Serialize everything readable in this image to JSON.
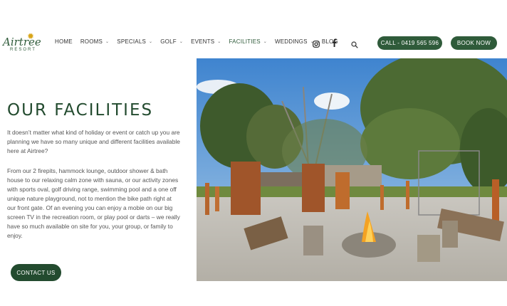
{
  "logo": {
    "name": "Airtree",
    "sub": "RESORT"
  },
  "nav": [
    {
      "label": "HOME",
      "dropdown": false
    },
    {
      "label": "ROOMS",
      "dropdown": true
    },
    {
      "label": "SPECIALS",
      "dropdown": true
    },
    {
      "label": "GOLF",
      "dropdown": true
    },
    {
      "label": "EVENTS",
      "dropdown": true
    },
    {
      "label": "FACILITIES",
      "dropdown": true
    },
    {
      "label": "WEDDINGS",
      "dropdown": true
    },
    {
      "label": "BLOG",
      "dropdown": false
    }
  ],
  "header": {
    "call_label": "CALL - 0419 565 596",
    "book_label": "BOOK NOW"
  },
  "main": {
    "title": "OUR FACILITIES",
    "intro": "It doesn’t matter what kind of holiday or event or catch up you are planning we have so many unique and different facilities available here at Airtree?",
    "body": "From our 2 firepits, hammock lounge, outdoor shower & bath house to our relaxing calm zone with sauna, or our activity zones with sports oval, golf driving range, swimming pool and a one off unique nature playground, not to mention the bike path right at our front gate. Of an evening you can enjoy a mobie on our big screen TV in the recreation room, or play pool or darts – we really have so much available on site for you, your group, or family to enjoy.",
    "contact_label": "CONTACT US"
  },
  "colors": {
    "brand": "#2f5b3a",
    "brand_dark": "#234b2f"
  },
  "icons": [
    "instagram-icon",
    "facebook-icon",
    "search-icon",
    "chevron-down-icon"
  ]
}
